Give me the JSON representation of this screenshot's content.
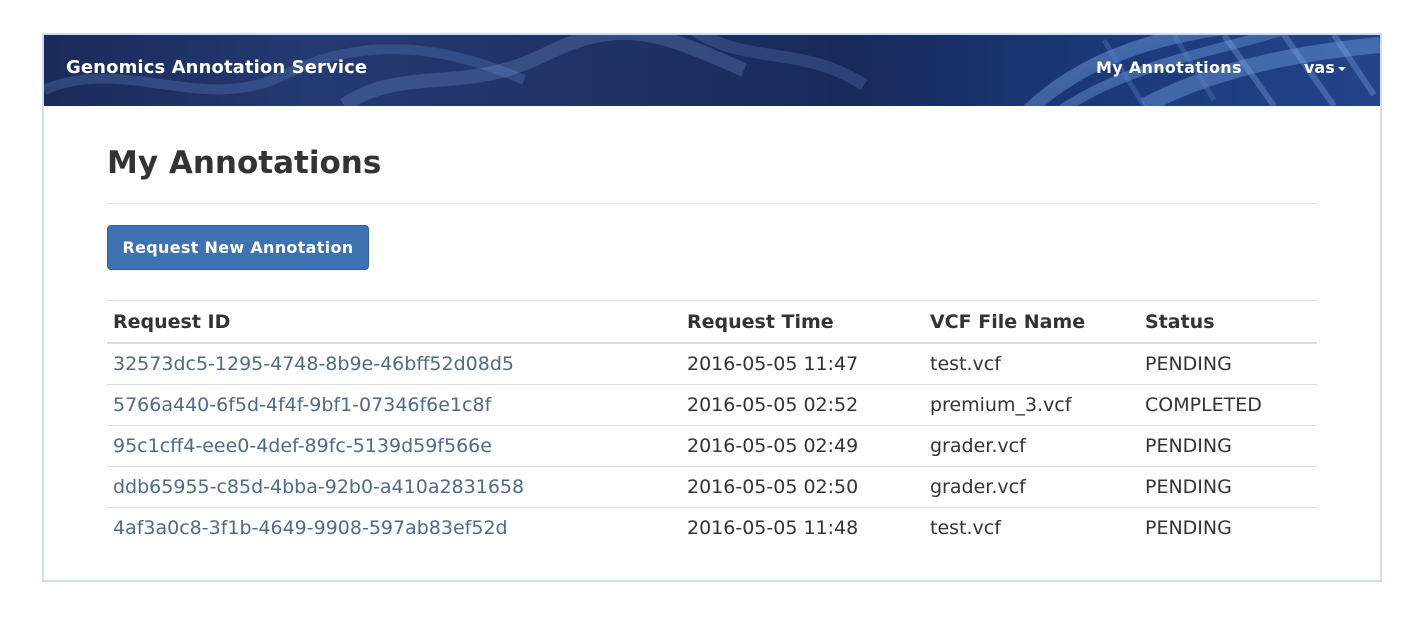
{
  "navbar": {
    "brand": "Genomics Annotation Service",
    "links": [
      {
        "label": "My Annotations"
      }
    ],
    "user": {
      "label": "vas"
    }
  },
  "page": {
    "title": "My Annotations",
    "request_button": "Request New Annotation"
  },
  "table": {
    "headers": [
      "Request ID",
      "Request Time",
      "VCF File Name",
      "Status"
    ],
    "rows": [
      {
        "id": "32573dc5-1295-4748-8b9e-46bff52d08d5",
        "time": "2016-05-05 11:47",
        "file": "test.vcf",
        "status": "PENDING"
      },
      {
        "id": "5766a440-6f5d-4f4f-9bf1-07346f6e1c8f",
        "time": "2016-05-05 02:52",
        "file": "premium_3.vcf",
        "status": "COMPLETED"
      },
      {
        "id": "95c1cff4-eee0-4def-89fc-5139d59f566e",
        "time": "2016-05-05 02:49",
        "file": "grader.vcf",
        "status": "PENDING"
      },
      {
        "id": "ddb65955-c85d-4bba-92b0-a410a2831658",
        "time": "2016-05-05 02:50",
        "file": "grader.vcf",
        "status": "PENDING"
      },
      {
        "id": "4af3a0c8-3f1b-4649-9908-597ab83ef52d",
        "time": "2016-05-05 11:48",
        "file": "test.vcf",
        "status": "PENDING"
      }
    ]
  },
  "colors": {
    "navbar": "#1f3366",
    "primary_button": "#3f72b1",
    "link": "#4e6a8a",
    "frame_border": "#cfddee"
  },
  "icons": {
    "user_menu": "caret-down-icon"
  }
}
